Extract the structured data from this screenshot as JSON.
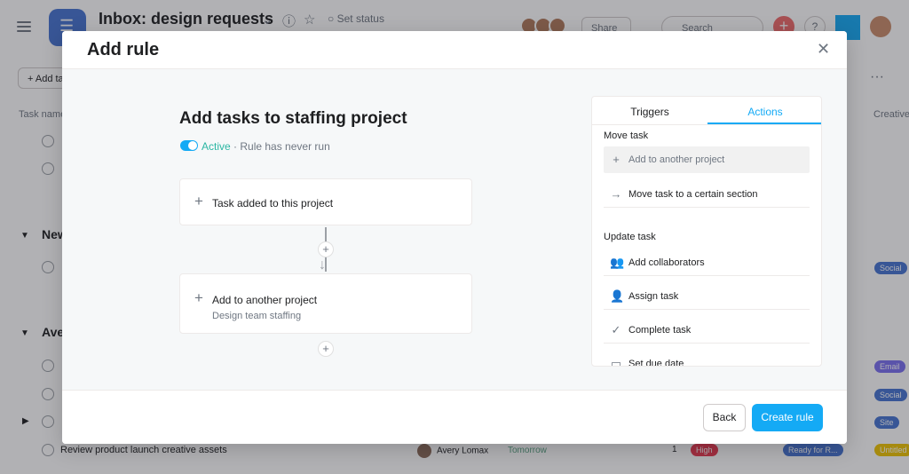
{
  "background": {
    "project_title": "Inbox: design requests",
    "set_status": "Set status",
    "share_label": "Share",
    "search_placeholder": "Search",
    "help_label": "?",
    "add_task_label": "+ Add ta",
    "more_label": "···",
    "col_task_name": "Task name",
    "col_creative": "Creative",
    "sections": [
      {
        "label": "New"
      },
      {
        "label": "Ave"
      }
    ],
    "last_row": {
      "task": "Review product launch creative assets",
      "assignee": "Avery Lomax",
      "due": "Tomorrow",
      "count": "1",
      "priority": "High",
      "status": "Ready for R...",
      "extra": "Untitled"
    },
    "tags": [
      "Social",
      "Email",
      "Social",
      "Site"
    ],
    "colors": {
      "accent": "#14aaf5",
      "priority_high": "#e8384f",
      "tag_blue": "#4573d2",
      "tag_purple": "#7a6ff0",
      "tag_yellow": "#eec300"
    }
  },
  "modal": {
    "title": "Add rule",
    "close_icon": "close-icon",
    "rule": {
      "title": "Add tasks to staffing project",
      "status_active": "Active",
      "status_rest": " · Rule has never run",
      "trigger_label": "Task added to this project",
      "action_label": "Add to another project",
      "action_sub": "Design team staffing"
    },
    "connector_add": "+",
    "panel": {
      "tabs": [
        "Triggers",
        "Actions"
      ],
      "active_tab": "Actions",
      "sections": {
        "move_task": "Move task",
        "update_task": "Update task"
      },
      "move_items": [
        {
          "icon": "plus-icon",
          "glyph": "+",
          "label": "Add to another project"
        },
        {
          "icon": "arrow-right-icon",
          "glyph": "→",
          "label": "Move task to a certain section"
        }
      ],
      "update_items": [
        {
          "icon": "collaborators-icon",
          "glyph": "👥",
          "label": "Add collaborators"
        },
        {
          "icon": "assign-icon",
          "glyph": "👤",
          "label": "Assign task"
        },
        {
          "icon": "check-circle-icon",
          "glyph": "✓",
          "label": "Complete task"
        },
        {
          "icon": "calendar-icon",
          "glyph": "▭",
          "label": "Set due date"
        }
      ]
    },
    "footer": {
      "back": "Back",
      "create": "Create rule"
    }
  }
}
